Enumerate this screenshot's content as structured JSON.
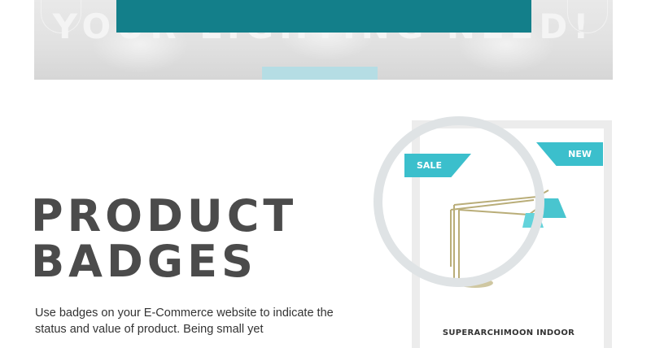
{
  "hero": {
    "headline": "YOUR LIGHTING NEED!",
    "accent_color": "#137f8a",
    "button_color": "#b5dde4"
  },
  "section": {
    "title_line1": "PRODUCT",
    "title_line2": "BADGES",
    "description": "Use badges on your E-Commerce website to indicate the status and value of product. Being small yet"
  },
  "product_card": {
    "badges": {
      "sale": "SALE",
      "new": "NEW",
      "color": "#3bbfcc"
    },
    "name": "SUPERARCHIMOON INDOOR"
  }
}
